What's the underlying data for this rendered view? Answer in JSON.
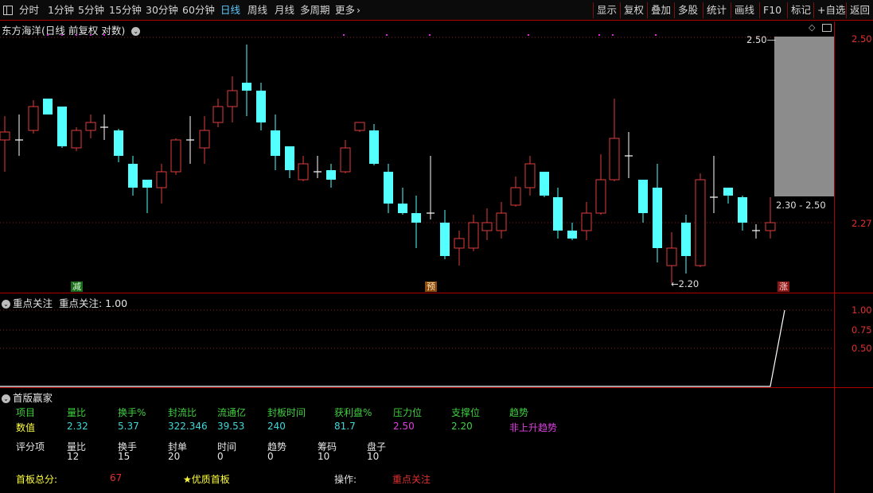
{
  "toolbar": {
    "periods": [
      "分时",
      "1分钟",
      "5分钟",
      "15分钟",
      "30分钟",
      "60分钟",
      "日线",
      "周线",
      "月线",
      "多周期",
      "更多"
    ],
    "active_period": "日线",
    "right_buttons": [
      "显示",
      "复权",
      "叠加",
      "多股",
      "统计",
      "画线",
      "F10",
      "标记",
      "+自选",
      "返回"
    ]
  },
  "main_chart": {
    "title": "东方海洋(日线 前复权 对数)",
    "price_axis": [
      "2.50",
      "2.27"
    ],
    "price_range_label": "2.30 - 2.50",
    "high_marker": "2.50",
    "low_marker": "2.20",
    "tags": [
      {
        "text": "减",
        "color": "#2e9e2e"
      },
      {
        "text": "预",
        "color": "#b86a10"
      },
      {
        "text": "涨",
        "color": "#b02020"
      }
    ],
    "colors": {
      "up": "#e03c3c",
      "down": "#54ffff",
      "doji": "#ffffff",
      "range_box": "#8c8c8c",
      "event_dots": "#e020e0"
    }
  },
  "indicator_panel": {
    "title": "重点关注",
    "value_label": "重点关注: 1.00",
    "axis": [
      "1.00",
      "0.75",
      "0.50"
    ],
    "series": [
      0,
      0,
      0,
      0,
      0,
      0,
      0,
      0,
      0,
      0,
      0,
      0,
      0,
      0,
      0,
      0,
      0,
      0,
      0,
      0,
      0,
      0,
      0,
      0,
      0,
      0,
      0,
      0,
      0,
      0,
      0,
      0,
      0,
      0,
      0,
      0,
      0,
      0,
      0,
      0,
      0,
      0,
      0,
      0,
      0,
      0,
      0,
      0,
      0,
      0,
      0,
      0,
      0,
      0,
      1
    ]
  },
  "scoring_panel": {
    "title": "首版赢家",
    "headers": [
      "项目",
      "量比",
      "换手%",
      "封流比",
      "流通亿",
      "封板时间",
      "获利盘%",
      "压力位",
      "支撑位",
      "趋势"
    ],
    "values": [
      "数值",
      "2.32",
      "5.37",
      "322.346",
      "39.53",
      "240",
      "81.7",
      "2.50",
      "2.20",
      "非上升趋势"
    ],
    "score_labels": [
      "评分项",
      "量比",
      "换手",
      "封单",
      "时间",
      "趋势",
      "筹码",
      "盘子"
    ],
    "score_values": [
      "",
      "12",
      "15",
      "20",
      "0",
      "0",
      "10",
      "10"
    ],
    "total_label": "首板总分:",
    "total_value": "67",
    "quality": "★优质首板",
    "operation_label": "操作:",
    "operation_value": "重点关注"
  }
}
